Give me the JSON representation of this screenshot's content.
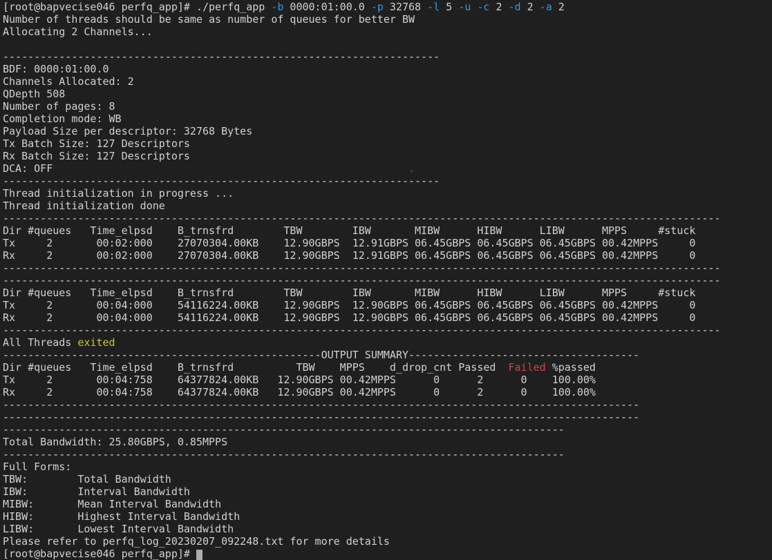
{
  "colors": {
    "background": "#1f1f1f",
    "foreground": "#d2d2d2",
    "flag_blue": "#3a96dd",
    "status_yellow": "#c3c832",
    "failed_red": "#cf4545",
    "cursor_gray": "#acacac"
  },
  "report": {
    "prompt": "[root@bapvecise046 perfq_app]#",
    "command": "./perfq_app -b 0000:01:00.0 -p 32768 -l 5 -u -c 2 -d 2 -a 2",
    "notes": [
      "Number of threads should be same as number of queues for better BW",
      "Allocating 2 Channels..."
    ],
    "config": {
      "BDF": "0000:01:00.0",
      "Channels Allocated": "2",
      "QDepth": "508",
      "Number of pages": "8",
      "Completion mode": "WB",
      "Payload Size per descriptor": "32768 Bytes",
      "Tx Batch Size": "127 Descriptors",
      "Rx Batch Size": "127 Descriptors",
      "DCA": "OFF"
    },
    "thread_status": [
      "Thread initialization in progress ...",
      "Thread initialization done",
      "All Threads exited"
    ],
    "interval_tables": [
      {
        "headers": [
          "Dir",
          "#queues",
          "Time_elpsd",
          "B_trnsfrd",
          "TBW",
          "IBW",
          "MIBW",
          "HIBW",
          "LIBW",
          "MPPS",
          "#stuck"
        ],
        "rows": [
          [
            "Tx",
            "2",
            "00:02:000",
            "27070304.00KB",
            "12.90GBPS",
            "12.91GBPS",
            "06.45GBPS",
            "06.45GBPS",
            "06.45GBPS",
            "00.42MPPS",
            "0"
          ],
          [
            "Rx",
            "2",
            "00:02:000",
            "27070304.00KB",
            "12.90GBPS",
            "12.91GBPS",
            "06.45GBPS",
            "06.45GBPS",
            "06.45GBPS",
            "00.42MPPS",
            "0"
          ]
        ]
      },
      {
        "headers": [
          "Dir",
          "#queues",
          "Time_elpsd",
          "B_trnsfrd",
          "TBW",
          "IBW",
          "MIBW",
          "HIBW",
          "LIBW",
          "MPPS",
          "#stuck"
        ],
        "rows": [
          [
            "Tx",
            "2",
            "00:04:000",
            "54116224.00KB",
            "12.90GBPS",
            "12.90GBPS",
            "06.45GBPS",
            "06.45GBPS",
            "06.45GBPS",
            "00.42MPPS",
            "0"
          ],
          [
            "Rx",
            "2",
            "00:04:000",
            "54116224.00KB",
            "12.90GBPS",
            "12.90GBPS",
            "06.45GBPS",
            "06.45GBPS",
            "06.45GBPS",
            "00.42MPPS",
            "0"
          ]
        ]
      }
    ],
    "output_summary": {
      "title": "OUTPUT SUMMARY",
      "headers": [
        "Dir",
        "#queues",
        "Time_elpsd",
        "B_trnsfrd",
        "TBW",
        "MPPS",
        "d_drop_cnt",
        "Passed",
        "Failed",
        "%passed"
      ],
      "rows": [
        [
          "Tx",
          "2",
          "00:04:758",
          "64377824.00KB",
          "12.90GBPS",
          "00.42MPPS",
          "0",
          "2",
          "0",
          "100.00%"
        ],
        [
          "Rx",
          "2",
          "00:04:758",
          "64377824.00KB",
          "12.90GBPS",
          "00.42MPPS",
          "0",
          "2",
          "0",
          "100.00%"
        ]
      ]
    },
    "total_bandwidth": "Total Bandwidth: 25.80GBPS, 0.85MPPS",
    "full_forms": {
      "title": "Full Forms:",
      "TBW": "Total Bandwidth",
      "IBW": "Interval Bandwidth",
      "MIBW": "Mean Interval Bandwidth",
      "HIBW": "Highest Interval Bandwidth",
      "LIBW": "Lowest Interval Bandwidth"
    },
    "log_note": "Please refer to perfq_log_20230207_092248.txt for more details"
  },
  "terminal": {
    "lines": [
      {
        "s": [
          {
            "t": "[root@bapvecise046 perfq_app]# ./perfq_app ",
            "n": "shell-prompt-and-command"
          },
          {
            "t": "-b",
            "c": "blue",
            "n": "command-flag"
          },
          {
            "t": " 0000:01:00.0 "
          },
          {
            "t": "-p",
            "c": "blue",
            "n": "command-flag"
          },
          {
            "t": " 32768 "
          },
          {
            "t": "-l",
            "c": "blue",
            "n": "command-flag"
          },
          {
            "t": " 5 "
          },
          {
            "t": "-u",
            "c": "blue",
            "n": "command-flag"
          },
          {
            "t": " "
          },
          {
            "t": "-c",
            "c": "blue",
            "n": "command-flag"
          },
          {
            "t": " 2 "
          },
          {
            "t": "-d",
            "c": "blue",
            "n": "command-flag"
          },
          {
            "t": " 2 "
          },
          {
            "t": "-a",
            "c": "blue",
            "n": "command-flag"
          },
          {
            "t": " 2"
          }
        ]
      },
      {
        "t": "Number of threads should be same as number of queues for better BW"
      },
      {
        "t": "Allocating 2 Channels..."
      },
      {
        "t": ""
      },
      {
        "t": "----------------------------------------------------------------------"
      },
      {
        "t": "BDF: 0000:01:00.0"
      },
      {
        "t": "Channels Allocated: 2"
      },
      {
        "t": "QDepth 508"
      },
      {
        "t": "Number of pages: 8"
      },
      {
        "t": "Completion mode: WB"
      },
      {
        "t": "Payload Size per descriptor: 32768 Bytes"
      },
      {
        "t": "Tx Batch Size: 127 Descriptors"
      },
      {
        "t": "Rx Batch Size: 127 Descriptors"
      },
      {
        "s": [
          {
            "t": "DCA: OFF"
          },
          {
            "t": "                                                         "
          },
          {
            "t": ".",
            "c": "dim",
            "n": "stray-dot"
          }
        ]
      },
      {
        "t": "----------------------------------------------------------------------"
      },
      {
        "t": "Thread initialization in progress ..."
      },
      {
        "t": "Thread initialization done"
      },
      {
        "t": "-------------------------------------------------------------------------------------------------------------------"
      },
      {
        "t": "Dir #queues   Time_elpsd    B_trnsfrd        TBW        IBW       MIBW      HIBW      LIBW      MPPS     #stuck"
      },
      {
        "t": "Tx     2       00:02:000    27070304.00KB    12.90GBPS  12.91GBPS 06.45GBPS 06.45GBPS 06.45GBPS 00.42MPPS     0"
      },
      {
        "t": "Rx     2       00:02:000    27070304.00KB    12.90GBPS  12.91GBPS 06.45GBPS 06.45GBPS 06.45GBPS 00.42MPPS     0"
      },
      {
        "t": "-------------------------------------------------------------------------------------------------------------------"
      },
      {
        "t": "-------------------------------------------------------------------------------------------------------------------"
      },
      {
        "t": "Dir #queues   Time_elpsd    B_trnsfrd        TBW        IBW       MIBW      HIBW      LIBW      MPPS     #stuck"
      },
      {
        "t": "Tx     2       00:04:000    54116224.00KB    12.90GBPS  12.90GBPS 06.45GBPS 06.45GBPS 06.45GBPS 00.42MPPS     0"
      },
      {
        "t": "Rx     2       00:04:000    54116224.00KB    12.90GBPS  12.90GBPS 06.45GBPS 06.45GBPS 06.45GBPS 00.42MPPS     0"
      },
      {
        "t": "-------------------------------------------------------------------------------------------------------------------"
      },
      {
        "s": [
          {
            "t": "All Threads "
          },
          {
            "t": "exited",
            "c": "yellow",
            "n": "thread-exit-status"
          }
        ]
      },
      {
        "t": "---------------------------------------------------OUTPUT SUMMARY-------------------------------------"
      },
      {
        "s": [
          {
            "t": "Dir #queues   Time_elpsd    B_trnsfrd          TBW    MPPS    d_drop_cnt Passed  "
          },
          {
            "t": "Failed",
            "c": "red",
            "n": "failed-column-header"
          },
          {
            "t": " %passed"
          }
        ]
      },
      {
        "t": "Tx     2       00:04:758    64377824.00KB   12.90GBPS 00.42MPPS      0      2      0    100.00%"
      },
      {
        "t": "Rx     2       00:04:758    64377824.00KB   12.90GBPS 00.42MPPS      0      2      0    100.00%"
      },
      {
        "t": "------------------------------------------------------------------------------------------------------"
      },
      {
        "t": "------------------------------------------------------------------------------------------------------"
      },
      {
        "t": "------------------------------------------------------------------------------------------"
      },
      {
        "t": "Total Bandwidth: 25.80GBPS, 0.85MPPS"
      },
      {
        "t": "------------------------------------------------------------------------------------------"
      },
      {
        "t": "Full Forms:"
      },
      {
        "t": "TBW:        Total Bandwidth"
      },
      {
        "t": "IBW:        Interval Bandwidth"
      },
      {
        "t": "MIBW:       Mean Interval Bandwidth"
      },
      {
        "t": "HIBW:       Highest Interval Bandwidth"
      },
      {
        "t": "LIBW:       Lowest Interval Bandwidth"
      },
      {
        "t": "Please refer to perfq_log_20230207_092248.txt for more details"
      },
      {
        "t": "[root@bapvecise046 perfq_app]# ",
        "cursor": true
      }
    ]
  }
}
